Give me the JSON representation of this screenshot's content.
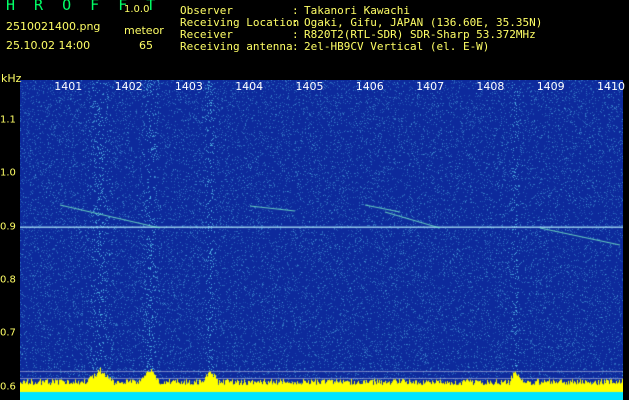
{
  "header": {
    "app_title": "H R O F F T",
    "app_version": "1.0.0",
    "file_name": "2510021400.png",
    "date_time": "25.10.02 14:00",
    "meteor_label": "meteor",
    "meteor_count": "65"
  },
  "station": [
    {
      "label": "Observer",
      "value": "Takanori Kawachi"
    },
    {
      "label": "Receiving Location",
      "value": "Ogaki, Gifu, JAPAN (136.60E, 35.35N)"
    },
    {
      "label": "Receiver",
      "value": "R820T2(RTL-SDR) SDR-Sharp 53.372MHz"
    },
    {
      "label": "Receiving antenna",
      "value": "2el-HB9CV Vertical (el. E-W)"
    }
  ],
  "separator": ":",
  "colors": {
    "background": "#000000",
    "plot_background": "#0d2a9c",
    "noise_dots": "#3aa6d6",
    "label_yellow": "#ffff66",
    "title_green": "#00ff66",
    "tick_white": "#ffffff",
    "level_bar": "#ffff00",
    "level_bar_base": "#00e5ff"
  },
  "chart_data": {
    "type": "heatmap",
    "ylabel": "kHz",
    "x_ticks": [
      "1401",
      "1402",
      "1403",
      "1404",
      "1405",
      "1406",
      "1407",
      "1408",
      "1409",
      "1410"
    ],
    "y_ticks": [
      "1.1",
      "1.0",
      "0.9",
      "0.8",
      "0.7",
      "0.6"
    ],
    "y_tick_values": [
      1.1,
      1.0,
      0.9,
      0.8,
      0.7,
      0.6
    ],
    "x_range_minutes": [
      1400,
      1410
    ],
    "y_range_khz": [
      0.575,
      1.175
    ],
    "carrier_khz": 0.9,
    "meteor_count": 65
  }
}
